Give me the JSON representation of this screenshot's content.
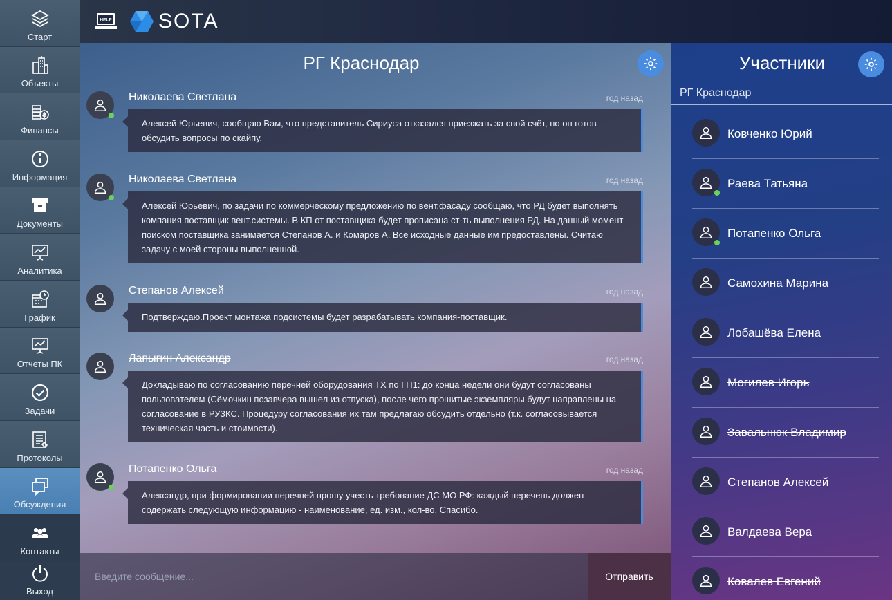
{
  "nav": {
    "items": [
      {
        "label": "Старт",
        "icon": "layers-icon"
      },
      {
        "label": "Объекты",
        "icon": "buildings-icon"
      },
      {
        "label": "Финансы",
        "icon": "money-icon"
      },
      {
        "label": "Информация",
        "icon": "info-icon"
      },
      {
        "label": "Документы",
        "icon": "archive-box-icon"
      },
      {
        "label": "Аналитика",
        "icon": "presentation-chart-icon"
      },
      {
        "label": "График",
        "icon": "calendar-clock-icon"
      },
      {
        "label": "Отчеты ПК",
        "icon": "report-board-icon"
      },
      {
        "label": "Задачи",
        "icon": "check-circle-icon"
      },
      {
        "label": "Протоколы",
        "icon": "document-lines-icon"
      },
      {
        "label": "Обсуждения",
        "icon": "chat-windows-icon"
      },
      {
        "label": "Контакты",
        "icon": "people-group-icon"
      },
      {
        "label": "Выход",
        "icon": "power-icon"
      }
    ],
    "active": "Обсуждения"
  },
  "header": {
    "help_label": "HELP",
    "logo_text": "SOTA"
  },
  "chat": {
    "title": "РГ Краснодар",
    "messages": [
      {
        "author": "Николаева Светлана",
        "time": "год назад",
        "online": true,
        "struck": false,
        "text": "Алексей Юрьевич, сообщаю Вам, что представитель Сириуса отказался приезжать за свой счёт, но он готов обсудить вопросы по скайпу."
      },
      {
        "author": "Николаева Светлана",
        "time": "год назад",
        "online": true,
        "struck": false,
        "text": "Алексей Юрьевич, по задачи по коммерческому предложению по вент.фасаду сообщаю, что РД будет выполнять компания поставщик вент.системы. В КП от поставщика будет прописана ст-ть выполнения РД. На данный момент поиском поставщика занимается Степанов А. и Комаров А. Все исходные данные им предоставлены. Считаю задачу с моей стороны выполненной."
      },
      {
        "author": "Степанов Алексей",
        "time": "год назад",
        "online": false,
        "struck": false,
        "text": "Подтверждаю.Проект монтажа подсистемы будет разрабатывать компания-поставщик."
      },
      {
        "author": "Лапыгин Александр",
        "time": "год назад",
        "online": false,
        "struck": true,
        "text": "Докладываю по согласованию перечней оборудования ТХ по ГП1: до конца недели они будут согласованы пользователем (Сёмочкин позавчера вышел из отпуска), после чего прошитые экземпляры будут направлены на согласование в РУЗКС. Процедуру согласования их там предлагаю обсудить отдельно (т.к. согласовывается техническая часть и стоимости)."
      },
      {
        "author": "Потапенко Ольга",
        "time": "год назад",
        "online": true,
        "struck": false,
        "text": "Александр, при формировании перечней прошу учесть требование ДС МО РФ: каждый перечень должен содержать следующую информацию - наименование, ед. изм., кол-во. Спасибо."
      }
    ],
    "composer": {
      "placeholder": "Введите сообщение...",
      "send_label": "Отправить"
    }
  },
  "participants": {
    "title": "Участники",
    "group": "РГ Краснодар",
    "list": [
      {
        "name": "Ковченко Юрий",
        "online": false,
        "struck": false
      },
      {
        "name": "Раева Татьяна",
        "online": true,
        "struck": false
      },
      {
        "name": "Потапенко Ольга",
        "online": true,
        "struck": false
      },
      {
        "name": "Самохина Марина",
        "online": false,
        "struck": false
      },
      {
        "name": "Лобашёва Елена",
        "online": false,
        "struck": false
      },
      {
        "name": "Могилев Игорь",
        "online": false,
        "struck": true
      },
      {
        "name": "Завальнюк Владимир",
        "online": false,
        "struck": true
      },
      {
        "name": "Степанов Алексей",
        "online": false,
        "struck": false
      },
      {
        "name": "Валдаева Вера",
        "online": false,
        "struck": true
      },
      {
        "name": "Ковалев Евгений",
        "online": false,
        "struck": true
      }
    ]
  },
  "colors": {
    "accent": "#4a8de0",
    "online": "#6bd35a",
    "sidebar": "#3d5063",
    "active_nav": "#5b8fc0"
  }
}
